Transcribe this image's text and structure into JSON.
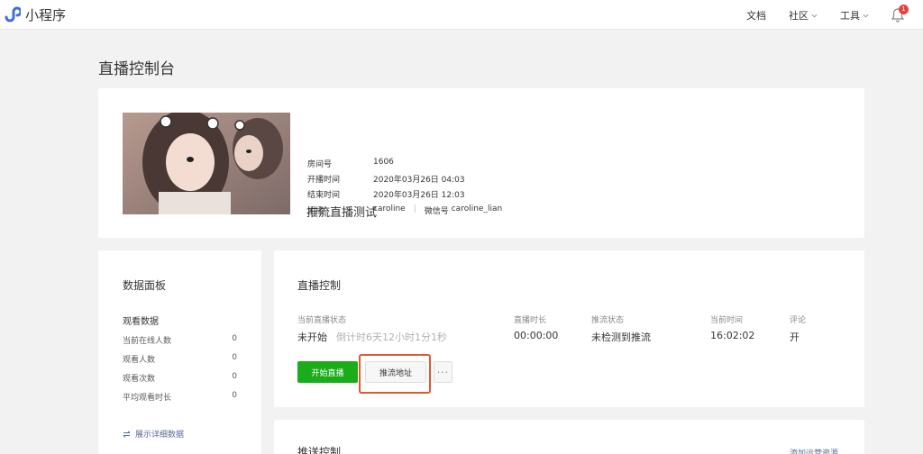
{
  "nav": {
    "app_name": "小程序",
    "docs": "文档",
    "community": "社区",
    "tools": "工具",
    "badge_count": "1"
  },
  "page": {
    "title": "直播控制台"
  },
  "room": {
    "name": "推流直播测试",
    "fields": [
      {
        "label": "房间号",
        "value": "1606"
      },
      {
        "label": "开播时间",
        "value": "2020年03月26日 04:03"
      },
      {
        "label": "结束时间",
        "value": "2020年03月26日 12:03"
      }
    ],
    "host_label": "主播",
    "host_name": "caroline",
    "wechat_label": "微信号",
    "wechat_id": "caroline_lian"
  },
  "data_panel": {
    "title": "数据面板",
    "subtitle": "观看数据",
    "stats": [
      {
        "label": "当前在线人数",
        "value": "0"
      },
      {
        "label": "观看人数",
        "value": "0"
      },
      {
        "label": "观看次数",
        "value": "0"
      },
      {
        "label": "平均观看时长",
        "value": "0"
      }
    ],
    "show_more": "展示详细数据"
  },
  "control": {
    "title": "直播控制",
    "status_label": "当前直播状态",
    "status_value": "未开始",
    "countdown": "倒计时6天12小时1分1秒",
    "duration_label": "直播时长",
    "duration_value": "00:00:00",
    "stream_label": "推流状态",
    "stream_value": "未检测到推流",
    "time_label": "当前时间",
    "time_value": "16:02:02",
    "comment_label": "评论",
    "comment_value": "开",
    "start_button": "开始直播",
    "push_url_button": "推流地址",
    "more_button": "···"
  },
  "push": {
    "title": "推送控制",
    "add_link": "添加运营资源"
  },
  "colors": {
    "primary_green": "#1aad19",
    "link_blue": "#576b95",
    "highlight_red": "#e4572e",
    "badge_red": "#e64340"
  }
}
